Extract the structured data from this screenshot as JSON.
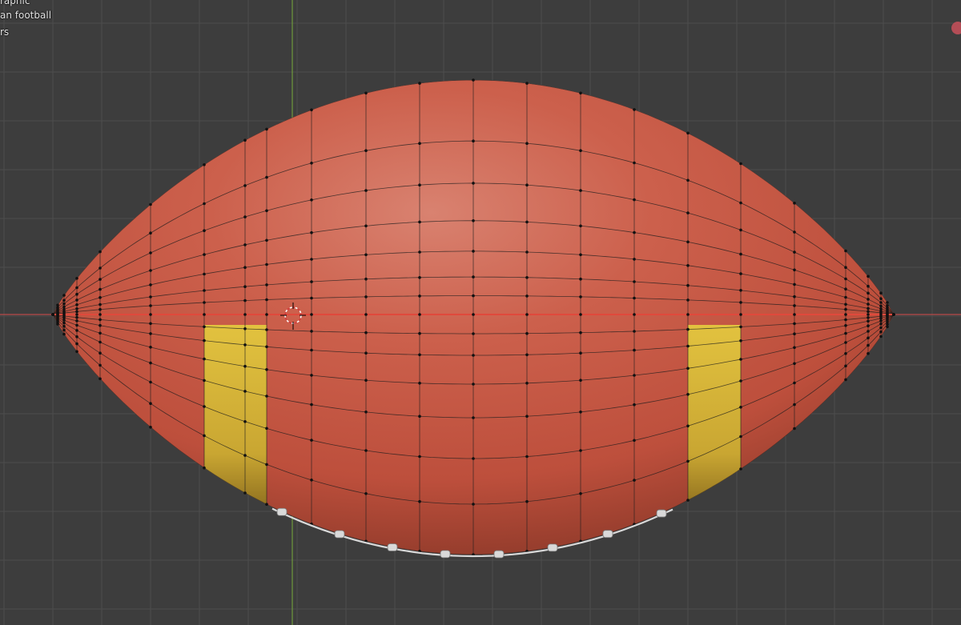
{
  "overlay": {
    "view_mode_fragment": "raphic",
    "object_name_fragment": "an football",
    "units_fragment": "rs"
  },
  "colors": {
    "background": "#3d3d3d",
    "grid_line": "#4d4d4d",
    "x_axis": "#b84a48",
    "y_axis": "#6f9a3d",
    "ball_base": "#c85a46",
    "ball_highlight": "#d98270",
    "ball_shadow": "#8f3a2a",
    "stripe": "#d8b53a",
    "wire": "#1d1d1d",
    "lace": "#d9d9d9"
  },
  "icons": {
    "cursor": "3d-cursor-icon",
    "record": "record-indicator-icon"
  }
}
